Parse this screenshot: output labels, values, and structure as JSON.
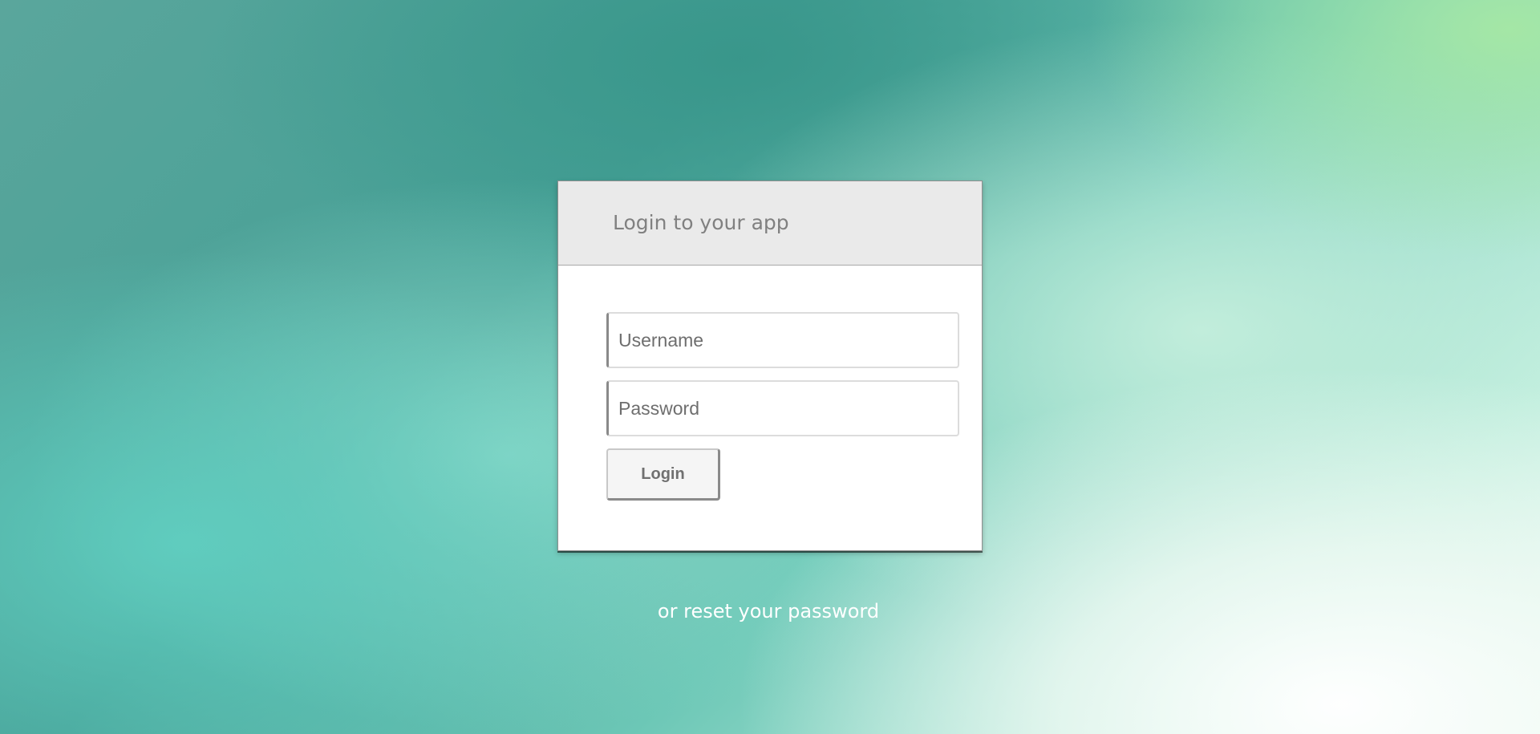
{
  "login_panel": {
    "title": "Login to your app",
    "username_placeholder": "Username",
    "password_placeholder": "Password",
    "login_button_label": "Login"
  },
  "footer": {
    "reset_link_text": "or reset your password"
  },
  "colors": {
    "panel_header_bg": "#eaeaea",
    "panel_bg": "#ffffff",
    "title_text": "#808080",
    "reset_link_text": "#ffffff"
  }
}
